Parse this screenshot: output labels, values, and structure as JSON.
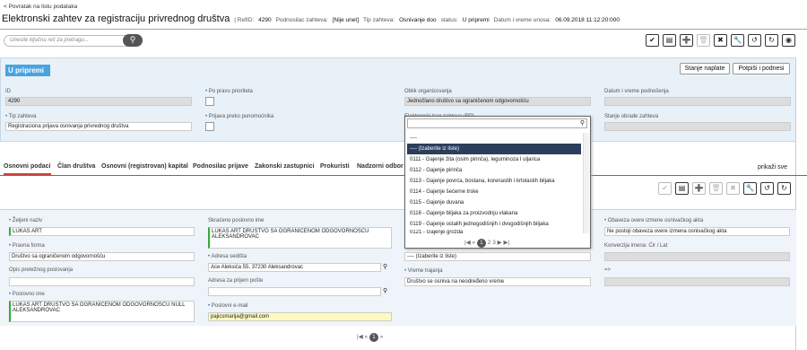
{
  "back_link": "< Povratak na listu podataka",
  "title": "Elektronski zahtev za registraciju privrednog društva",
  "meta": {
    "refid_label": "| RefID:",
    "refid": "4290",
    "podnosilac_label": "Podnosilac zahteva:",
    "podnosilac": "[Nije unet]",
    "tip_label": "Tip zahteva:",
    "tip": "Osnivanje doo",
    "status_label": "status:",
    "status": "U pripremi",
    "datum_label": "Datum i vreme unosa:",
    "datum": "06.09.2018 11:12:20:000"
  },
  "search": {
    "placeholder": "Unesite ključnu reč za pretragu..."
  },
  "status_badge": "U pripremi",
  "buttons": {
    "stanje_naplate": "Stanje naplate",
    "potpisi": "Potpiši i podnesi",
    "prikazi_sve": "prikaži sve"
  },
  "fields": {
    "id_label": "ID",
    "id_value": "4290",
    "po_pravu_label": "Po pravu prioriteta",
    "oblik_label": "Oblik organizovanja",
    "oblik_value": "Jednočlano društvo sa ograničenom odgovornošću",
    "datum_podnosenja_label": "Datum i vreme podnošenja",
    "tip_zahteva_label": "Tip zahteva",
    "tip_zahteva_value": "Registraciona prijava osnivanja privrednog društva",
    "prijava_label": "Prijava preko punomoćnika",
    "elektronski_label": "Elektronski trag zahteva (RP)",
    "stanje_obrade_label": "Stanje obrade zahteva"
  },
  "tabs": [
    "Osnovni podaci",
    "Član društva",
    "Osnovni (registrovan) kapital",
    "Podnosilac prijave",
    "Zakonski zastupnici",
    "Prokuristi",
    "Nadzorni odbor"
  ],
  "form": {
    "zeljeni_naziv_label": "Željeni naziv",
    "zeljeni_naziv_value": "LUKAS ART",
    "skraceno_label": "Skraćeno poslovno ime",
    "skraceno_value": "LUKAS ART DRUŠTVO SA OGRANIČENOM ODGOVORNOŠĆU ALEKSANDROVAC",
    "obaveza_label": "Obaveza overe izmene osnivačkog akta",
    "obaveza_value": "Ne postoji obaveza overe izmena osnivačkog akta",
    "pravna_forma_label": "Pravna forma",
    "pravna_forma_value": "Društvo sa ograničenom odgovornošću",
    "adresa_sedista_label": "Adresa sedišta",
    "adresa_sedista_value": "Ace Aleksića 55, 37230 Aleksandrovac",
    "konverzija_label": "Konverzija imena: Ćir / Lat",
    "izaberite_value": "---- (Izaberite iz liste)",
    "arrow_label": "=>",
    "opis_label": "Opis pretežnog poslovanja",
    "adresa_prijem_label": "Adresa za prijem pošte",
    "vreme_trajanja_label": "Vreme trajanja",
    "vreme_trajanja_value": "Društvo se osniva na neodređeno vreme",
    "poslovno_ime_label": "Poslovno ime",
    "poslovno_ime_value": "LUKAS ART DRUŠTVO SA OGRANIČENOM ODGOVORNOŠĆU NULL ALEKSANDROVAC",
    "email_label": "Poslovni e-mail",
    "email_value": "pajicsmarija@gmail.com"
  },
  "dropdown": {
    "items": [
      "----",
      "---- (Izaberite iz liste)",
      "0111 - Gajenje žita (osim pirinča), leguminoza I uljarica",
      "0112 - Gajenje pirinča",
      "0113 - Gajenje povrća, bostana, korenastih i krtolastih biljaka",
      "0114 - Gajenje šećerne trske",
      "0115 - Gajenje duvana",
      "0116 - Gajenje biljaka za proizvodnju vlakana",
      "0119 - Gajenje ostalih jednogodišnjih i dvogodišnjih biljaka",
      "0121 - Gajenje grožđa"
    ],
    "selected_index": 1,
    "pages": [
      "1",
      "2",
      "3"
    ]
  },
  "bottom_pager": {
    "current": "1"
  }
}
